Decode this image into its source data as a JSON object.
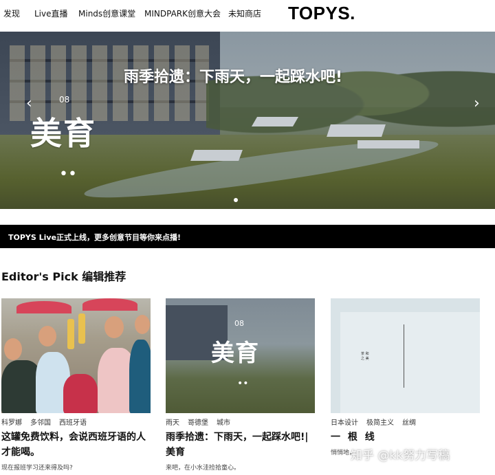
{
  "nav": {
    "items": [
      "发现",
      "Live直播",
      "Minds创意课堂",
      "MINDPARK创意大会",
      "未知商店"
    ],
    "logo": "TOPYS."
  },
  "hero": {
    "title": "雨季拾遗：下雨天，一起踩水吧!",
    "overlay_number": "08",
    "overlay_text": "美育",
    "overlay_dots": "••",
    "prev_icon": "chevron-left-icon",
    "next_icon": "chevron-right-icon",
    "prev_glyph": "‹",
    "next_glyph": "›"
  },
  "announcement": "TOPYS Live正式上线，更多创意节目等你来点播!",
  "section_title": "Editor's Pick 编辑推荐",
  "cards": [
    {
      "tags": [
        "科罗娜",
        "多邻国",
        "西班牙语"
      ],
      "title": "这罐免费饮料，会说西班牙语的人才能喝。",
      "desc": "现在报班学习还来得及吗?"
    },
    {
      "tags": [
        "雨天",
        "哥德堡",
        "城市"
      ],
      "title": "雨季拾遗：下雨天，一起踩水吧!| 美育",
      "desc": "来吧，在小水洼捡拾童心。",
      "image_number": "08",
      "image_text": "美育",
      "image_dots": "••"
    },
    {
      "tags": [
        "日本设计",
        "极简主义",
        "丝绸"
      ],
      "title": "一 根 线",
      "desc": "悄悄地，",
      "image_mini": [
        "茶",
        "和",
        "之",
        "美"
      ]
    }
  ],
  "watermark": "知乎 @kk努力写稿"
}
